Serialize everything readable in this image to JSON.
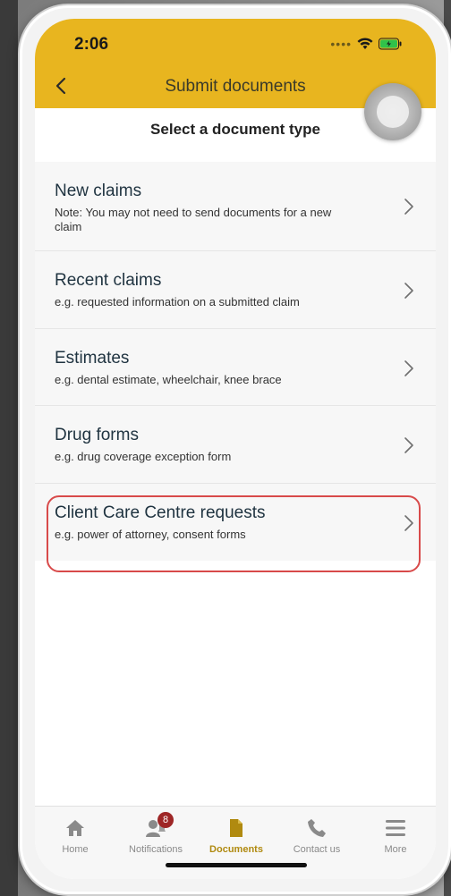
{
  "status_bar": {
    "time": "2:06"
  },
  "header": {
    "back_icon": "chevron-left-icon",
    "title": "Submit documents"
  },
  "section": {
    "title": "Select a document type"
  },
  "document_types": [
    {
      "title": "New claims",
      "note": "Note: You may not need to send documents for a new claim"
    },
    {
      "title": "Recent claims",
      "note": "e.g. requested information on a submitted claim"
    },
    {
      "title": "Estimates",
      "note": "e.g. dental estimate, wheelchair, knee brace"
    },
    {
      "title": "Drug forms",
      "note": "e.g. drug coverage exception form"
    },
    {
      "title": "Client Care Centre requests",
      "note": "e.g. power of attorney, consent forms"
    }
  ],
  "tab_bar": {
    "tabs": [
      {
        "label": "Home",
        "icon": "home-icon"
      },
      {
        "label": "Notifications",
        "icon": "notifications-icon",
        "badge": "8"
      },
      {
        "label": "Documents",
        "icon": "document-icon",
        "active": true
      },
      {
        "label": "Contact us",
        "icon": "phone-icon"
      },
      {
        "label": "More",
        "icon": "menu-icon"
      }
    ]
  },
  "colors": {
    "header_yellow": "#e8b51f",
    "highlight_red": "#d84a4a",
    "active_tab": "#b08a10",
    "badge": "#9e2626"
  }
}
